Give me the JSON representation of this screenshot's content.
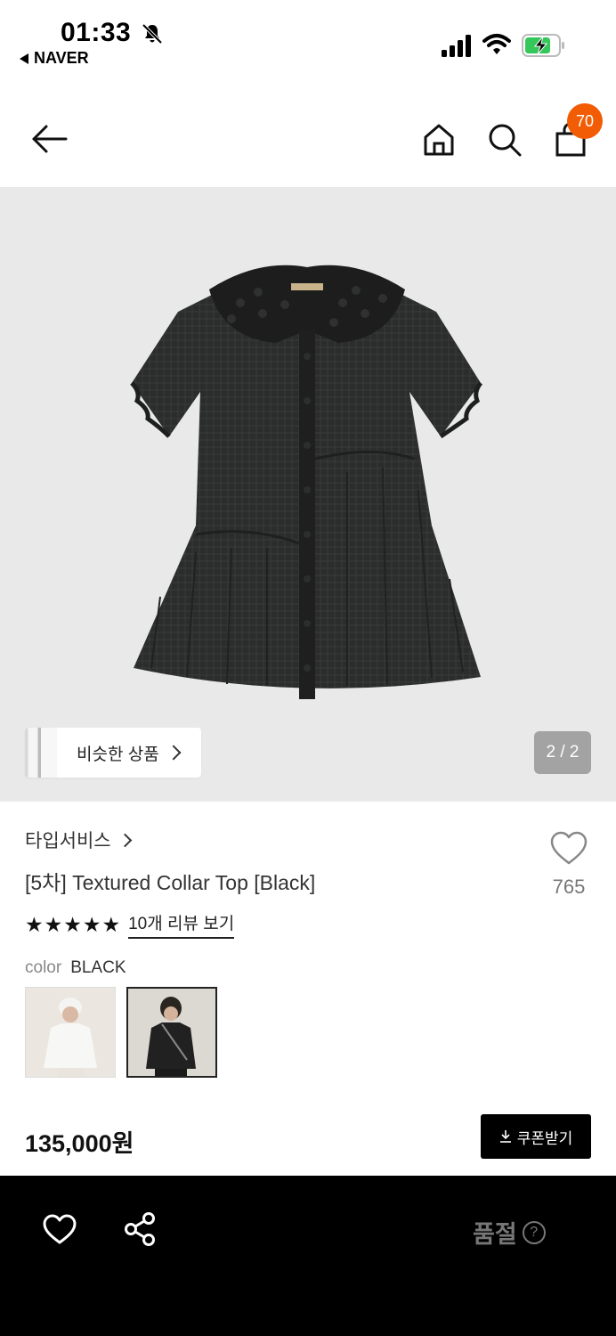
{
  "status_bar": {
    "time": "01:33",
    "back_app": "NAVER",
    "icons": [
      "bell-muted-icon",
      "signal-icon",
      "wifi-icon",
      "battery-charging-icon"
    ]
  },
  "header": {
    "icons": [
      "back-arrow-icon",
      "home-icon",
      "search-icon",
      "shopping-bag-icon"
    ],
    "cart_count": "70",
    "badge_color": "#f25c05"
  },
  "gallery": {
    "similar_label": "비슷한 상품",
    "page_indicator": "2 / 2"
  },
  "product": {
    "brand": "타입서비스",
    "title": "[5차] Textured Collar Top [Black]",
    "like_count": "765",
    "rating_stars": "★★★★★",
    "rating_value": 5,
    "review_link": "10개 리뷰 보기",
    "color_label": "color",
    "color_value": "BLACK",
    "price": "135,000원",
    "coupon_label": "쿠폰받기"
  },
  "bottom_bar": {
    "soldout_label": "품절",
    "help_glyph": "?",
    "icons": [
      "heart-icon",
      "share-icon",
      "help-circle-icon"
    ]
  }
}
